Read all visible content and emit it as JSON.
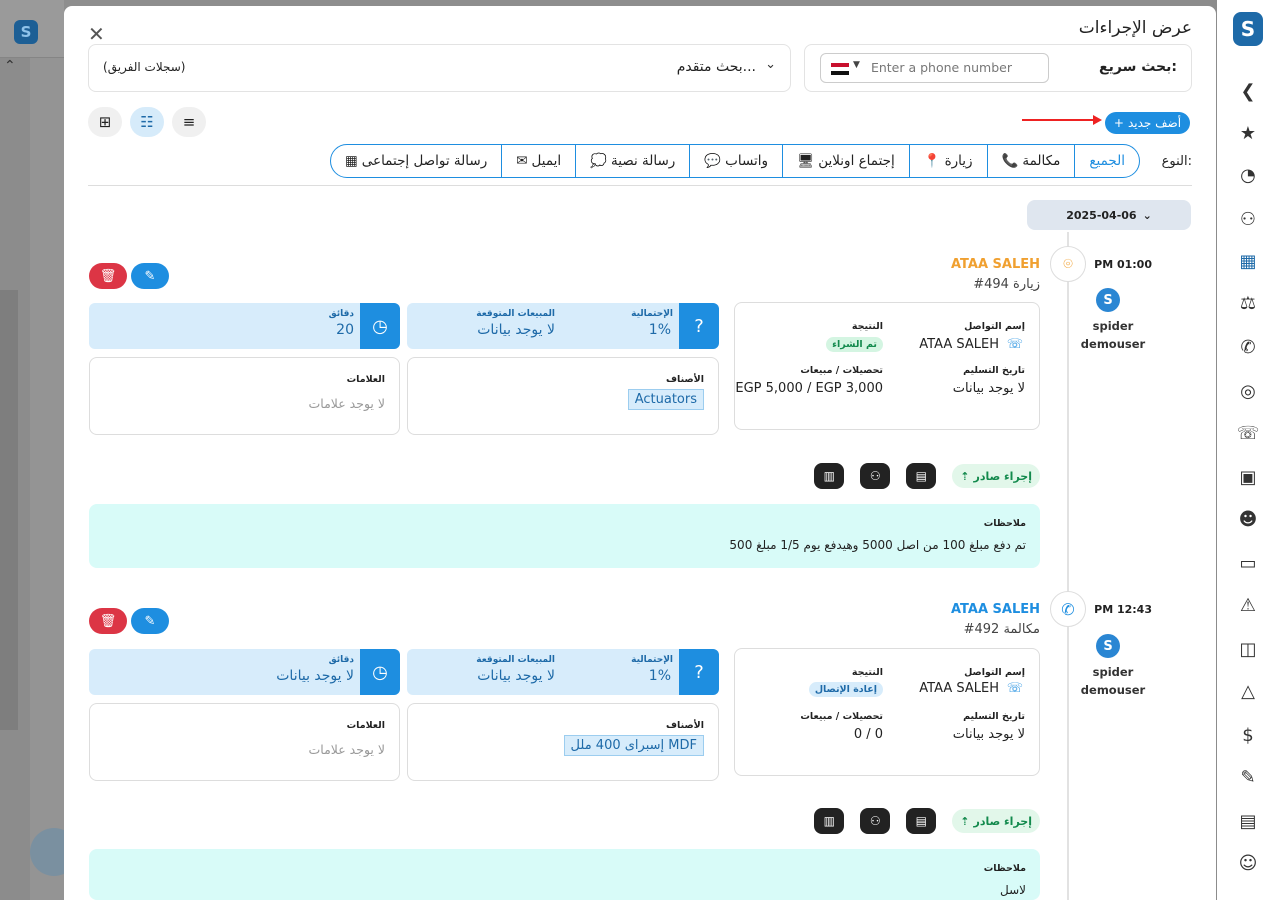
{
  "modal": {
    "title": "عرض الإجراءات",
    "close": "✕",
    "quick_search": {
      "label": "بحث سريع:",
      "phone_placeholder": "Enter a phone number"
    },
    "advanced_search": {
      "label": "بحث متقدم..."
    },
    "team_records": "(سجلات الفريق)",
    "add_new": "أضف جديد",
    "type_label": "النوع:",
    "filters": [
      {
        "label": "الجميع",
        "icon": ""
      },
      {
        "label": "مكالمة",
        "icon": "📞"
      },
      {
        "label": "زيارة",
        "icon": "📍"
      },
      {
        "label": "إجتماع اونلاين",
        "icon": "🖥"
      },
      {
        "label": "واتساب",
        "icon": "💬"
      },
      {
        "label": "رسالة نصية",
        "icon": "💭"
      },
      {
        "label": "ايميل",
        "icon": "✉"
      },
      {
        "label": "رسالة تواصل إجتماعى",
        "icon": "▦"
      }
    ],
    "date_group": "2025-04-06"
  },
  "activities": [
    {
      "time": "PM 01:00",
      "user_line1": "spider",
      "user_line2": "demouser",
      "name": "ATAA SALEH",
      "subtitle": "#494 زيارة",
      "contact_label": "إسم التواصل",
      "contact_value": "ATAA SALEH",
      "result_label": "النتيجة",
      "result_value": "تم الشراء",
      "delivery_label": "تاريخ التسليم",
      "delivery_value": "لا يوجد بيانات",
      "collections_label": "تحصيلات / مبيعات",
      "collections_value": "EGP 5,000 / EGP 3,000",
      "probability_label": "الإحتمالية",
      "probability_value": "1%",
      "expected_label": "المبيعات المتوقعة",
      "expected_value": "لا يوجد بيانات",
      "minutes_label": "دقائق",
      "minutes_value": "20",
      "categories_label": "الأصناف",
      "category_value": "Actuators",
      "tags_label": "العلامات",
      "tags_value": "لا يوجد علامات",
      "outgoing": "إجراء صادر",
      "notes_label": "ملاحظات",
      "notes_value": "تم دفع مبلغ 100 من اصل 5000 وهيدفع يوم 1/5 مبلغ 500"
    },
    {
      "time": "PM 12:43",
      "user_line1": "spider",
      "user_line2": "demouser",
      "name": "ATAA SALEH",
      "subtitle": "#492 مكالمة",
      "contact_label": "إسم التواصل",
      "contact_value": "ATAA SALEH",
      "result_label": "النتيجة",
      "result_value": "إعادة الإتصال",
      "delivery_label": "تاريخ التسليم",
      "delivery_value": "لا يوجد بيانات",
      "collections_label": "تحصيلات / مبيعات",
      "collections_value": "0 / 0",
      "probability_label": "الإحتمالية",
      "probability_value": "1%",
      "expected_label": "المبيعات المتوقعة",
      "expected_value": "لا يوجد بيانات",
      "minutes_label": "دقائق",
      "minutes_value": "لا يوجد بيانات",
      "categories_label": "الأصناف",
      "category_value": "إسبراى 400 ملل MDF",
      "tags_label": "العلامات",
      "tags_value": "لا يوجد علامات",
      "outgoing": "إجراء صادر",
      "notes_label": "ملاحظات",
      "notes_value": "لاسل"
    }
  ],
  "colors": {
    "accent": "#1e8ee0",
    "danger": "#dc3545",
    "visit": "#f0a030",
    "notes_bg": "#d8fbf8"
  }
}
